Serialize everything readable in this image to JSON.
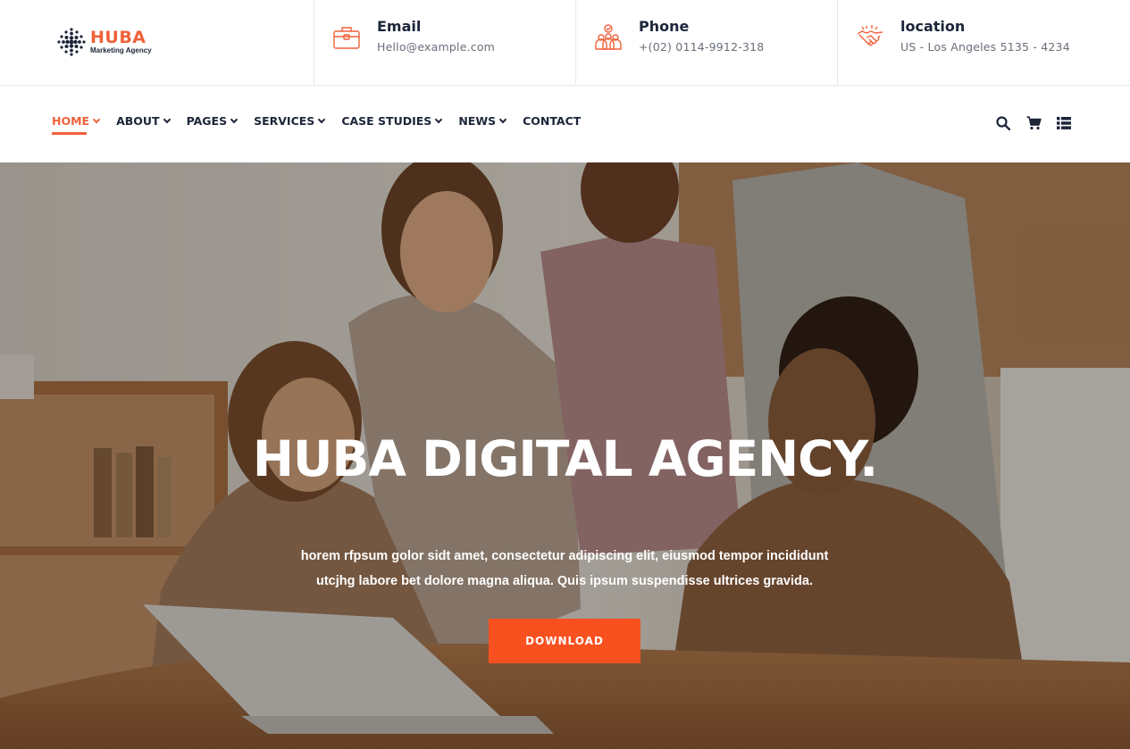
{
  "brand": {
    "name": "HUBA",
    "tagline": "Marketing Agency",
    "accent": "#f0613a"
  },
  "contact": [
    {
      "icon": "briefcase-icon",
      "title": "Email",
      "value": "Hello@example.com"
    },
    {
      "icon": "team-icon",
      "title": "Phone",
      "value": "+(02) 0114-9912-318"
    },
    {
      "icon": "handshake-icon",
      "title": "location",
      "value": "US - Los Angeles 5135 - 4234"
    }
  ],
  "nav": {
    "items": [
      {
        "label": "HOME",
        "dropdown": true,
        "active": true
      },
      {
        "label": "ABOUT",
        "dropdown": true
      },
      {
        "label": "PAGES",
        "dropdown": true
      },
      {
        "label": "SERVICES",
        "dropdown": true
      },
      {
        "label": "CASE STUDIES",
        "dropdown": true
      },
      {
        "label": "NEWS",
        "dropdown": true
      },
      {
        "label": "CONTACT",
        "dropdown": false
      }
    ],
    "icons": [
      "search-icon",
      "cart-icon",
      "list-menu-icon"
    ]
  },
  "hero": {
    "title": "HUBA DIGITAL AGENCY.",
    "description_line1": "horem rfpsum golor sidt amet, consectetur adipiscing elit, eiusmod tempor incididunt",
    "description_line2": "utcjhg labore bet dolore magna aliqua. Quis ipsum suspendisse ultrices gravida.",
    "button_label": "DOWNLOAD",
    "button_color": "#f9501f"
  }
}
